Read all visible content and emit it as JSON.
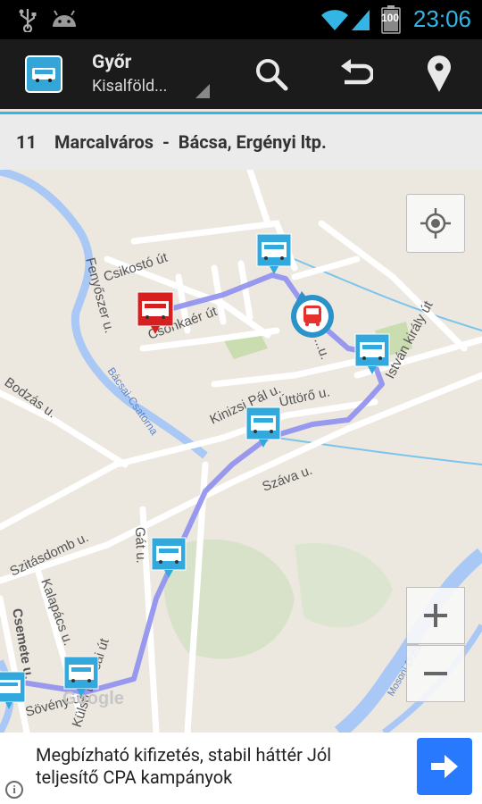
{
  "status_bar": {
    "time": "23:06",
    "battery_level": "100",
    "icons": [
      "usb-icon",
      "android-icon",
      "wifi-icon",
      "signal-icon",
      "battery-icon"
    ]
  },
  "action_bar": {
    "city": "Győr",
    "company": "Kisalföld...",
    "actions": [
      "search-icon",
      "undo-icon",
      "location-pin-icon"
    ]
  },
  "route": {
    "number": "11",
    "name": "Marcalváros  -  Bácsa, Ergényi ltp."
  },
  "map": {
    "streets": [
      "Csikostó út",
      "Fenyőszer u.",
      "Csonkaér út",
      "Bácsai-Csatorna",
      "Bodzás u.",
      "Kinizsi Pál u.",
      "Úttörő u.",
      "István király út",
      "Száva u.",
      "Szitásdomb u.",
      "Gát u.",
      "Kalapács u.",
      "Csemete u.",
      "Sövény u.",
      "Külső Bácsai út",
      "Mosoni-Duna",
      "...u."
    ],
    "watermark": "Google",
    "colors": {
      "route_line": "#8f8fef",
      "stop_marker": "#33a8dd",
      "selected_stop": "#d61f1f",
      "water": "#a9c8f5",
      "park": "#c9ddb0"
    }
  },
  "ad": {
    "text": "Megbízható kifizetés, stabil háttér Jól teljesítő CPA kampányok",
    "button_icon": "arrow-right-icon",
    "info_icon": "i"
  }
}
